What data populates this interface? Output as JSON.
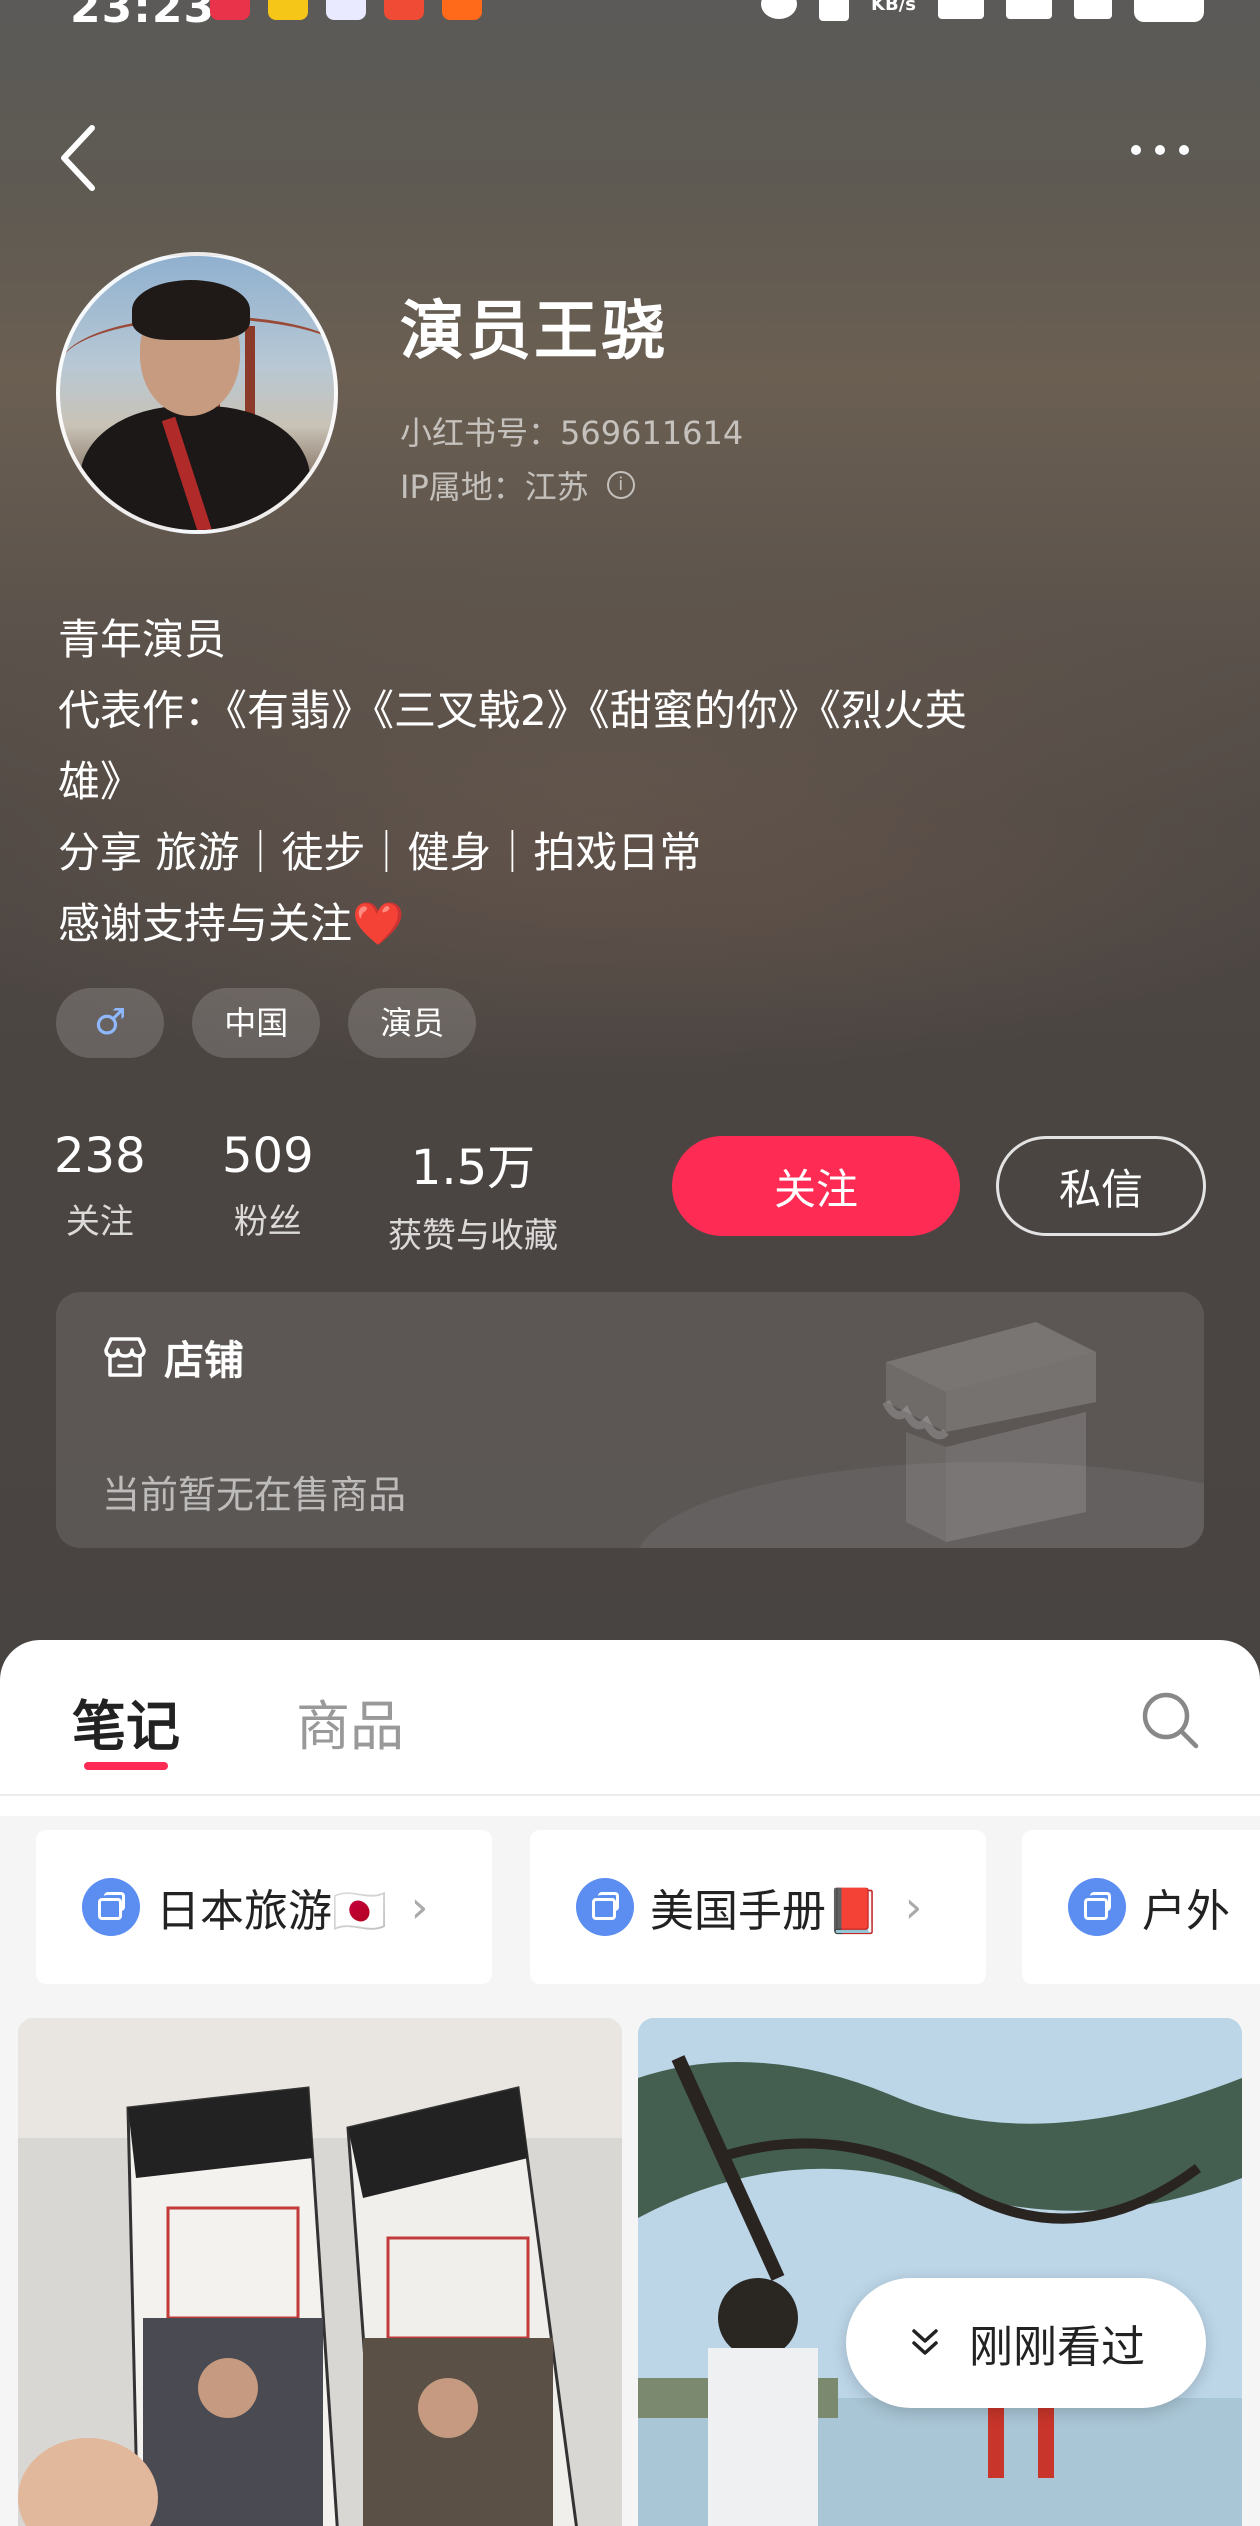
{
  "status_bar": {
    "time": "23:23",
    "network_speed_unit": "KB/s"
  },
  "profile": {
    "nickname": "演员王骁",
    "redbook_id": "小红书号：569611614",
    "ip_location": "IP属地：江苏",
    "bio": [
      "青年演员",
      "代表作：《有翡》《三叉戟2》《甜蜜的你》《烈火英",
      "雄》",
      "分享 旅游｜徒步｜健身｜拍戏日常",
      "感谢支持与关注"
    ],
    "bio_emoji": "❤️",
    "tags": {
      "gender": "♂",
      "region": "中国",
      "occupation": "演员"
    }
  },
  "stats": {
    "following_count": "238",
    "following_label": "关注",
    "followers_count": "509",
    "followers_label": "粉丝",
    "likes_count": "1.5万",
    "likes_label": "获赞与收藏"
  },
  "actions": {
    "follow_label": "关注",
    "message_label": "私信"
  },
  "shop": {
    "title": "店铺",
    "empty_text": "当前暂无在售商品"
  },
  "tabs": {
    "notes": "笔记",
    "products": "商品"
  },
  "collections": [
    {
      "label": "日本旅游🇯🇵"
    },
    {
      "label": "美国手册📕"
    },
    {
      "label": "户外"
    }
  ],
  "floating": {
    "recent_label": "刚刚看过"
  },
  "colors": {
    "accent": "#fe2c55",
    "collection_icon": "#5c8ef2"
  }
}
